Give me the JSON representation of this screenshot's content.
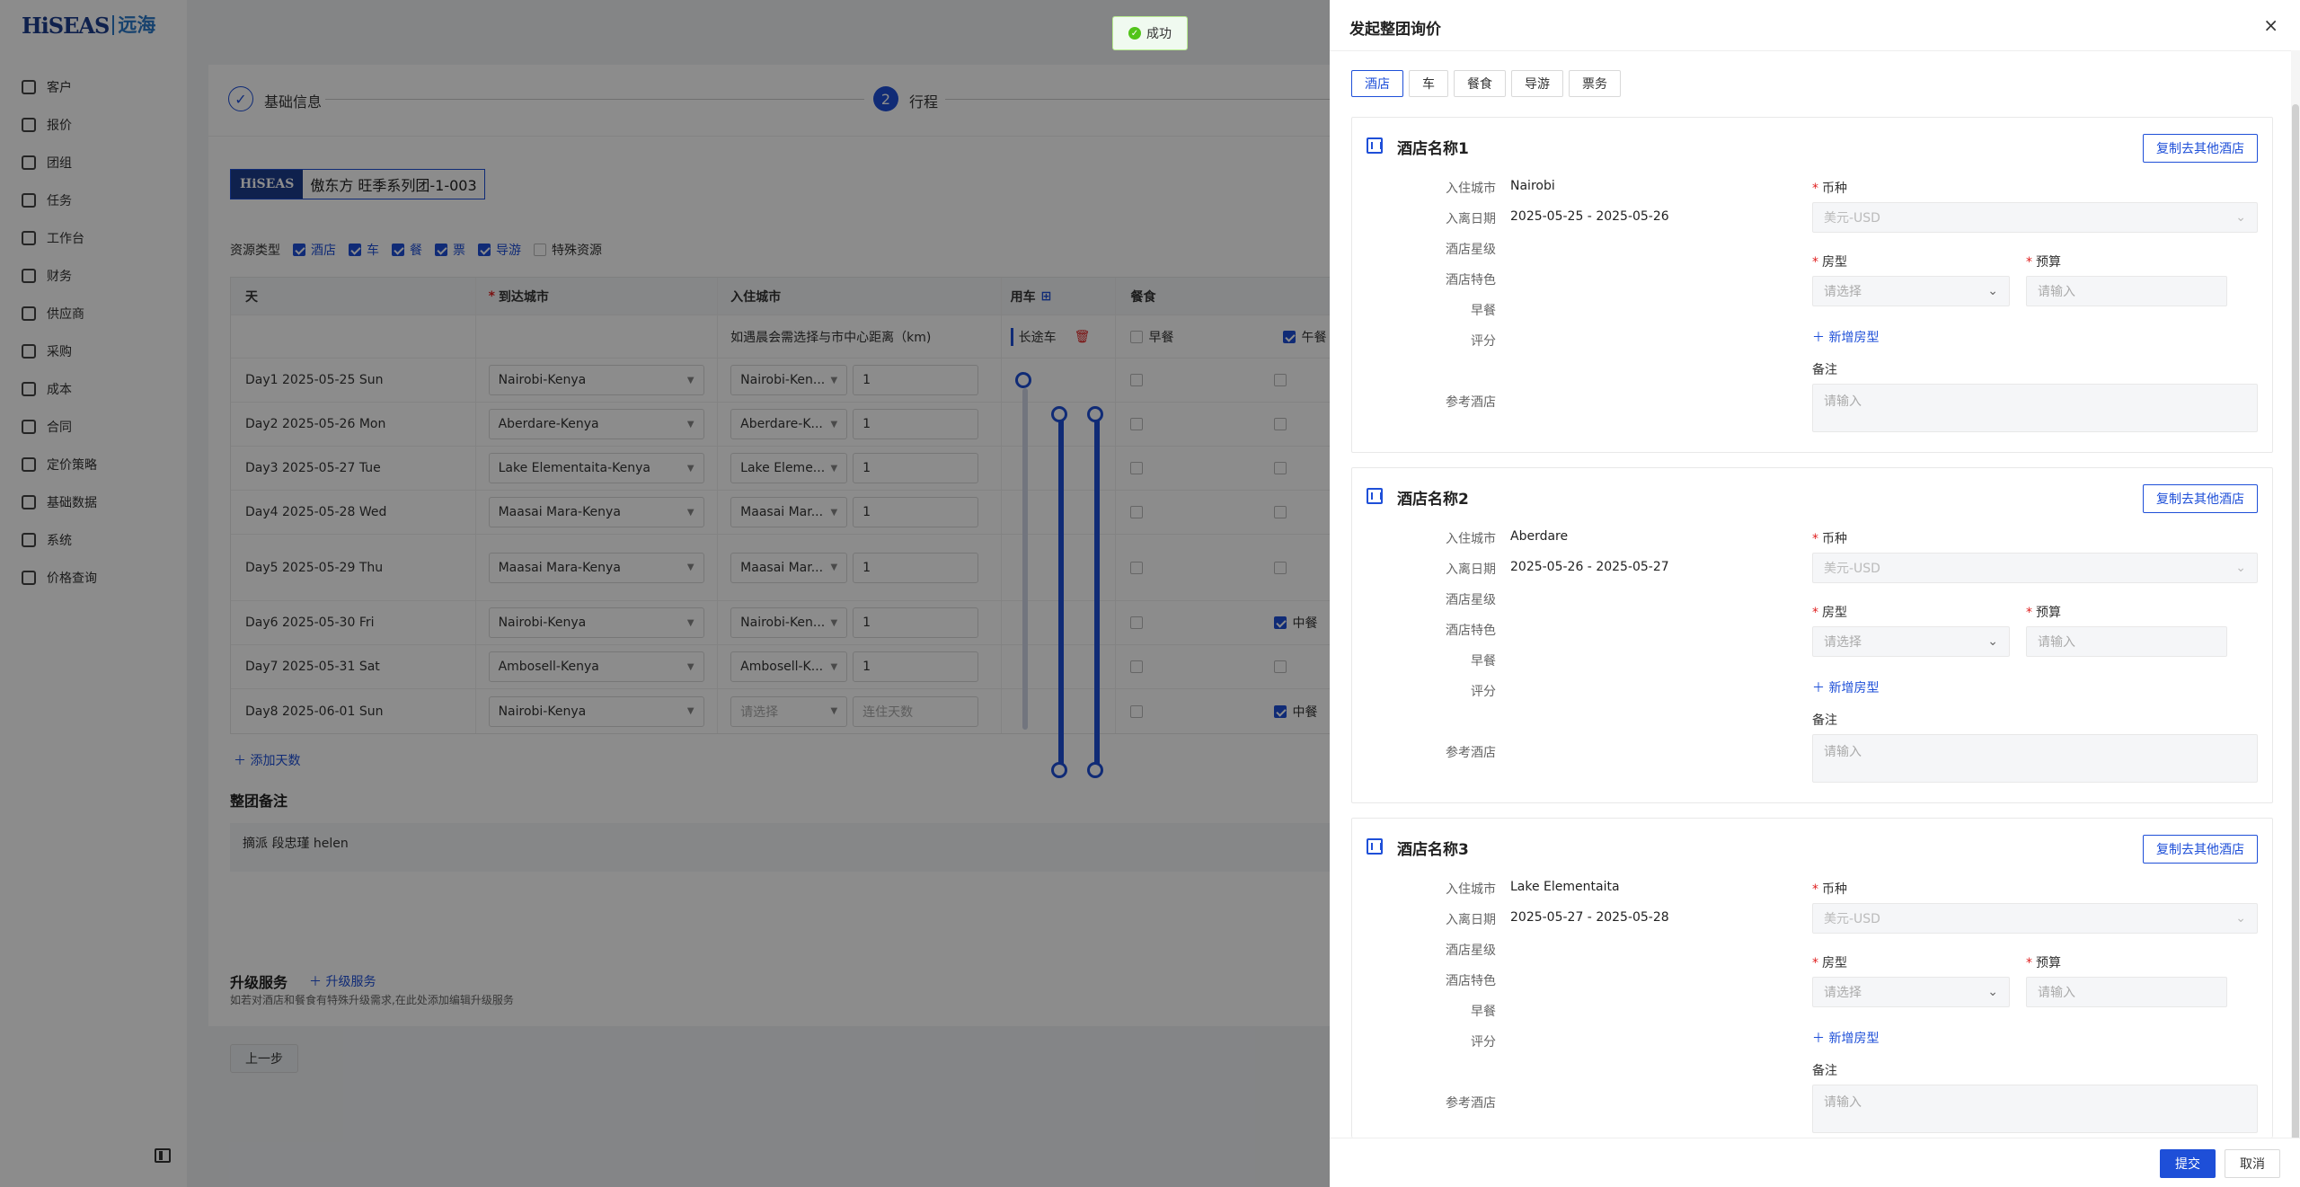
{
  "logo": {
    "main": "HiSEAS",
    "cn": "远海"
  },
  "sidebar": {
    "items": [
      {
        "label": "客户",
        "icon": "customer-icon"
      },
      {
        "label": "报价",
        "icon": "quote-icon"
      },
      {
        "label": "团组",
        "icon": "group-icon"
      },
      {
        "label": "任务",
        "icon": "task-icon"
      },
      {
        "label": "工作台",
        "icon": "workbench-icon"
      },
      {
        "label": "财务",
        "icon": "finance-icon"
      },
      {
        "label": "供应商",
        "icon": "supplier-icon"
      },
      {
        "label": "采购",
        "icon": "purchase-icon"
      },
      {
        "label": "成本",
        "icon": "cost-icon"
      },
      {
        "label": "合同",
        "icon": "contract-icon"
      },
      {
        "label": "定价策略",
        "icon": "pricing-icon"
      },
      {
        "label": "基础数据",
        "icon": "data-icon"
      },
      {
        "label": "系统",
        "icon": "system-icon"
      },
      {
        "label": "价格查询",
        "icon": "price-search-icon"
      }
    ]
  },
  "steps": {
    "step1": "基础信息",
    "step2_num": "2",
    "step2": "行程"
  },
  "group": {
    "logo": "HiSEAS",
    "name": "傲东方 旺季系列团-1-003"
  },
  "resources": {
    "label": "资源类型",
    "options": [
      "酒店",
      "车",
      "餐",
      "票",
      "导游"
    ],
    "special": "特殊资源"
  },
  "table": {
    "headers": {
      "day": "天",
      "city": "到达城市",
      "hotel": "入住城市",
      "car": "用车",
      "meal": "餐食"
    },
    "hotel_hint": "如遇晨会需选择与市中心距离（km)",
    "car_sub": "长途车",
    "breakfast": "早餐",
    "lunch": "午餐",
    "rows": [
      {
        "day": "Day1 2025-05-25 Sun",
        "city": "Nairobi-Kenya",
        "hotel": "Nairobi-Ken...",
        "nights": "1",
        "lunch": ""
      },
      {
        "day": "Day2 2025-05-26 Mon",
        "city": "Aberdare-Kenya",
        "hotel": "Aberdare-K...",
        "nights": "1",
        "lunch": ""
      },
      {
        "day": "Day3 2025-05-27 Tue",
        "city": "Lake Elementaita-Kenya",
        "hotel": "Lake Eleme...",
        "nights": "1",
        "lunch": ""
      },
      {
        "day": "Day4 2025-05-28 Wed",
        "city": "Maasai Mara-Kenya",
        "hotel": "Maasai Mar...",
        "nights": "1",
        "lunch": ""
      },
      {
        "day": "Day5 2025-05-29 Thu",
        "city": "Maasai Mara-Kenya",
        "hotel": "Maasai Mar...",
        "nights": "1",
        "lunch": ""
      },
      {
        "day": "Day6 2025-05-30 Fri",
        "city": "Nairobi-Kenya",
        "hotel": "Nairobi-Ken...",
        "nights": "1",
        "lunch": "中餐"
      },
      {
        "day": "Day7 2025-05-31 Sat",
        "city": "Ambosell-Kenya",
        "hotel": "Ambosell-K...",
        "nights": "1",
        "lunch": ""
      },
      {
        "day": "Day8 2025-06-01 Sun",
        "city": "Nairobi-Kenya",
        "hotel": "请选择",
        "nights": "连住天数",
        "lunch": "中餐"
      }
    ]
  },
  "add_day": "＋ 添加天数",
  "remark": {
    "title": "整团备注",
    "content": "摘派 段忠瑾  helen"
  },
  "upgrade": {
    "title": "升级服务",
    "link": "＋ 升级服务",
    "hint": "如若对酒店和餐食有特殊升级需求,在此处添加编辑升级服务"
  },
  "prev": "上一步",
  "toast": {
    "text": "成功",
    "icon": "check-circle-icon"
  },
  "drawer": {
    "title": "发起整团询价",
    "close": "×",
    "tabs": [
      "酒店",
      "车",
      "餐食",
      "导游",
      "票务"
    ],
    "labels": {
      "city": "入住城市",
      "date": "入离日期",
      "star": "酒店星级",
      "feature": "酒店特色",
      "breakfast": "早餐",
      "rating": "评分",
      "ref": "参考酒店",
      "currency": "币种",
      "room": "房型",
      "budget": "预算",
      "note": "备注"
    },
    "placeholders": {
      "select": "请选择",
      "input": "请输入",
      "currency": "美元-USD"
    },
    "copy": "复制去其他酒店",
    "add_room": "＋ 新增房型",
    "hotels": [
      {
        "name": "酒店名称1",
        "city": "Nairobi",
        "date": "2025-05-25 - 2025-05-26"
      },
      {
        "name": "酒店名称2",
        "city": "Aberdare",
        "date": "2025-05-26 - 2025-05-27"
      },
      {
        "name": "酒店名称3",
        "city": "Lake Elementaita",
        "date": "2025-05-27 - 2025-05-28"
      }
    ],
    "submit": "提交",
    "cancel": "取消"
  }
}
